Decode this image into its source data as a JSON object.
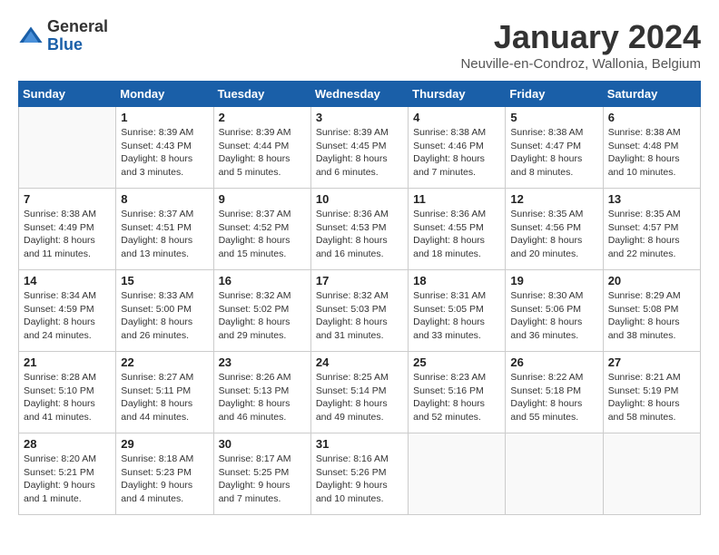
{
  "header": {
    "logo": {
      "general": "General",
      "blue": "Blue"
    },
    "title": "January 2024",
    "location": "Neuville-en-Condroz, Wallonia, Belgium"
  },
  "weekdays": [
    "Sunday",
    "Monday",
    "Tuesday",
    "Wednesday",
    "Thursday",
    "Friday",
    "Saturday"
  ],
  "weeks": [
    [
      {
        "day": "",
        "info": ""
      },
      {
        "day": "1",
        "info": "Sunrise: 8:39 AM\nSunset: 4:43 PM\nDaylight: 8 hours\nand 3 minutes."
      },
      {
        "day": "2",
        "info": "Sunrise: 8:39 AM\nSunset: 4:44 PM\nDaylight: 8 hours\nand 5 minutes."
      },
      {
        "day": "3",
        "info": "Sunrise: 8:39 AM\nSunset: 4:45 PM\nDaylight: 8 hours\nand 6 minutes."
      },
      {
        "day": "4",
        "info": "Sunrise: 8:38 AM\nSunset: 4:46 PM\nDaylight: 8 hours\nand 7 minutes."
      },
      {
        "day": "5",
        "info": "Sunrise: 8:38 AM\nSunset: 4:47 PM\nDaylight: 8 hours\nand 8 minutes."
      },
      {
        "day": "6",
        "info": "Sunrise: 8:38 AM\nSunset: 4:48 PM\nDaylight: 8 hours\nand 10 minutes."
      }
    ],
    [
      {
        "day": "7",
        "info": "Sunrise: 8:38 AM\nSunset: 4:49 PM\nDaylight: 8 hours\nand 11 minutes."
      },
      {
        "day": "8",
        "info": "Sunrise: 8:37 AM\nSunset: 4:51 PM\nDaylight: 8 hours\nand 13 minutes."
      },
      {
        "day": "9",
        "info": "Sunrise: 8:37 AM\nSunset: 4:52 PM\nDaylight: 8 hours\nand 15 minutes."
      },
      {
        "day": "10",
        "info": "Sunrise: 8:36 AM\nSunset: 4:53 PM\nDaylight: 8 hours\nand 16 minutes."
      },
      {
        "day": "11",
        "info": "Sunrise: 8:36 AM\nSunset: 4:55 PM\nDaylight: 8 hours\nand 18 minutes."
      },
      {
        "day": "12",
        "info": "Sunrise: 8:35 AM\nSunset: 4:56 PM\nDaylight: 8 hours\nand 20 minutes."
      },
      {
        "day": "13",
        "info": "Sunrise: 8:35 AM\nSunset: 4:57 PM\nDaylight: 8 hours\nand 22 minutes."
      }
    ],
    [
      {
        "day": "14",
        "info": "Sunrise: 8:34 AM\nSunset: 4:59 PM\nDaylight: 8 hours\nand 24 minutes."
      },
      {
        "day": "15",
        "info": "Sunrise: 8:33 AM\nSunset: 5:00 PM\nDaylight: 8 hours\nand 26 minutes."
      },
      {
        "day": "16",
        "info": "Sunrise: 8:32 AM\nSunset: 5:02 PM\nDaylight: 8 hours\nand 29 minutes."
      },
      {
        "day": "17",
        "info": "Sunrise: 8:32 AM\nSunset: 5:03 PM\nDaylight: 8 hours\nand 31 minutes."
      },
      {
        "day": "18",
        "info": "Sunrise: 8:31 AM\nSunset: 5:05 PM\nDaylight: 8 hours\nand 33 minutes."
      },
      {
        "day": "19",
        "info": "Sunrise: 8:30 AM\nSunset: 5:06 PM\nDaylight: 8 hours\nand 36 minutes."
      },
      {
        "day": "20",
        "info": "Sunrise: 8:29 AM\nSunset: 5:08 PM\nDaylight: 8 hours\nand 38 minutes."
      }
    ],
    [
      {
        "day": "21",
        "info": "Sunrise: 8:28 AM\nSunset: 5:10 PM\nDaylight: 8 hours\nand 41 minutes."
      },
      {
        "day": "22",
        "info": "Sunrise: 8:27 AM\nSunset: 5:11 PM\nDaylight: 8 hours\nand 44 minutes."
      },
      {
        "day": "23",
        "info": "Sunrise: 8:26 AM\nSunset: 5:13 PM\nDaylight: 8 hours\nand 46 minutes."
      },
      {
        "day": "24",
        "info": "Sunrise: 8:25 AM\nSunset: 5:14 PM\nDaylight: 8 hours\nand 49 minutes."
      },
      {
        "day": "25",
        "info": "Sunrise: 8:23 AM\nSunset: 5:16 PM\nDaylight: 8 hours\nand 52 minutes."
      },
      {
        "day": "26",
        "info": "Sunrise: 8:22 AM\nSunset: 5:18 PM\nDaylight: 8 hours\nand 55 minutes."
      },
      {
        "day": "27",
        "info": "Sunrise: 8:21 AM\nSunset: 5:19 PM\nDaylight: 8 hours\nand 58 minutes."
      }
    ],
    [
      {
        "day": "28",
        "info": "Sunrise: 8:20 AM\nSunset: 5:21 PM\nDaylight: 9 hours\nand 1 minute."
      },
      {
        "day": "29",
        "info": "Sunrise: 8:18 AM\nSunset: 5:23 PM\nDaylight: 9 hours\nand 4 minutes."
      },
      {
        "day": "30",
        "info": "Sunrise: 8:17 AM\nSunset: 5:25 PM\nDaylight: 9 hours\nand 7 minutes."
      },
      {
        "day": "31",
        "info": "Sunrise: 8:16 AM\nSunset: 5:26 PM\nDaylight: 9 hours\nand 10 minutes."
      },
      {
        "day": "",
        "info": ""
      },
      {
        "day": "",
        "info": ""
      },
      {
        "day": "",
        "info": ""
      }
    ]
  ]
}
